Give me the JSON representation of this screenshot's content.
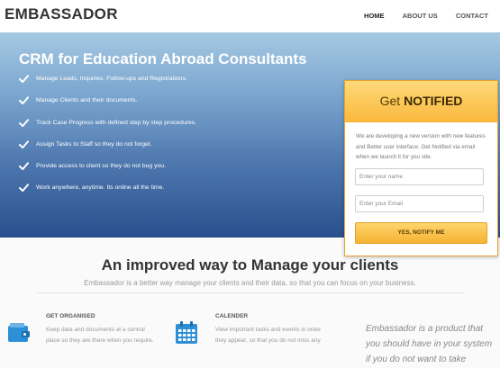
{
  "nav": {
    "logo": "EMBASSADOR",
    "links": [
      "HOME",
      "ABOUT US",
      "CONTACT"
    ]
  },
  "hero": {
    "title": "CRM for Education Abroad Consultants",
    "features": [
      "Manage Leads, Inquiries, Follow-ups and Registrations.",
      "Manage Clients and their documents.",
      "Track Case Progress with defined step by step procedures.",
      "Assign Tasks to Staff so they do not forget.",
      "Provide access to client so they do not bug you.",
      "Work anywhere, anytime. Its online all the time."
    ]
  },
  "signup": {
    "title_prefix": "Get",
    "title_bold": "NOTIFIED",
    "description": "We are developing a new version with new features and Better user interface. Get Notified via email when we launch it for you site.",
    "name_placeholder": "Enter your name",
    "email_placeholder": "Enter your Email",
    "button_label": "YES, NOTIFY ME"
  },
  "section": {
    "title": "An improved way to Manage your clients",
    "subtitle": "Embassador is a better way manage your clients and their data, so that you can focus on your business.",
    "features": [
      {
        "heading": "GET ORGANISED",
        "text_line1": "Keep data and documents at a central",
        "text_line2": "place so they are there when you require.",
        "icon": "wallet-icon"
      },
      {
        "heading": "CALENDER",
        "text_line1": "View important tasks and events in order",
        "text_line2": "they appear, so that you do not miss any",
        "icon": "calendar-icon"
      }
    ],
    "quote_line1": "Embassador is a product that",
    "quote_line2": "you should have in your system",
    "quote_line3": "if you do not want to take"
  },
  "colors": {
    "accent": "#f9b83c",
    "hero_top": "#a6c9e3",
    "hero_bottom": "#2a4f8d",
    "icon_blue": "#2d8fd5"
  }
}
